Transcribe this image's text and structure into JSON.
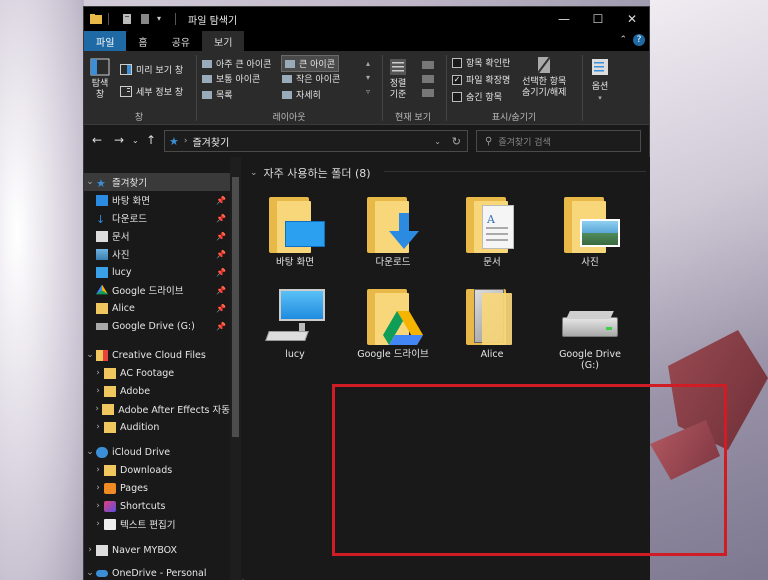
{
  "window": {
    "title": "파일 탐색기"
  },
  "ribbon_tabs": [
    "파일",
    "홈",
    "공유",
    "보기"
  ],
  "ribbon": {
    "pane_group": {
      "label": "창",
      "nav_pane": "탐색\n창",
      "preview_pane": "미리 보기 창",
      "details_pane": "세부 정보 창"
    },
    "layout_group": {
      "label": "레이아웃",
      "items": [
        "아주 큰 아이콘",
        "큰 아이콘",
        "보통 아이콘",
        "작은 아이콘",
        "목록",
        "자세히"
      ]
    },
    "current_view": {
      "label": "현재 보기",
      "sort": "정렬\n기준"
    },
    "show_hide": {
      "label": "표시/숨기기",
      "checkboxes": [
        {
          "label": "항목 확인란",
          "checked": false
        },
        {
          "label": "파일 확장명",
          "checked": true
        },
        {
          "label": "숨긴 항목",
          "checked": false
        }
      ],
      "hide_selected": "선택한 항목\n숨기기/해제"
    },
    "options": "옵션"
  },
  "address": {
    "path": "즐겨찾기",
    "search_placeholder": "즐겨찾기 검색"
  },
  "nav": [
    {
      "label": "즐겨찾기",
      "expanded": true,
      "level": 0,
      "selected": true,
      "icon": "star-icon"
    },
    {
      "label": "바탕 화면",
      "level": 1,
      "pinned": true,
      "icon": "desktop-icon"
    },
    {
      "label": "다운로드",
      "level": 1,
      "pinned": true,
      "icon": "download-icon"
    },
    {
      "label": "문서",
      "level": 1,
      "pinned": true,
      "icon": "document-icon"
    },
    {
      "label": "사진",
      "level": 1,
      "pinned": true,
      "icon": "picture-icon"
    },
    {
      "label": "lucy",
      "level": 1,
      "pinned": true,
      "icon": "computer-icon"
    },
    {
      "label": "Google 드라이브",
      "level": 1,
      "pinned": true,
      "icon": "google-drive-icon"
    },
    {
      "label": "Alice",
      "level": 1,
      "pinned": true,
      "icon": "folder-icon"
    },
    {
      "label": "Google Drive (G:)",
      "level": 1,
      "pinned": true,
      "icon": "drive-icon"
    },
    {
      "label": "Creative Cloud Files",
      "expanded": true,
      "level": 0,
      "icon": "creative-cloud-icon"
    },
    {
      "label": "AC Footage",
      "level": 1,
      "icon": "folder-icon"
    },
    {
      "label": "Adobe",
      "level": 1,
      "icon": "folder-icon"
    },
    {
      "label": "Adobe After Effects 자동",
      "level": 1,
      "icon": "folder-icon"
    },
    {
      "label": "Audition",
      "level": 1,
      "icon": "folder-icon"
    },
    {
      "label": "iCloud Drive",
      "expanded": true,
      "level": 0,
      "icon": "icloud-icon"
    },
    {
      "label": "Downloads",
      "level": 1,
      "icon": "folder-icon"
    },
    {
      "label": "Pages",
      "level": 1,
      "icon": "pages-icon"
    },
    {
      "label": "Shortcuts",
      "level": 1,
      "icon": "shortcuts-icon"
    },
    {
      "label": "텍스트 편집기",
      "level": 1,
      "icon": "textedit-icon"
    },
    {
      "label": "Naver MYBOX",
      "level": 0,
      "icon": "mybox-icon"
    },
    {
      "label": "OneDrive - Personal",
      "expanded": true,
      "level": 0,
      "icon": "onedrive-icon"
    }
  ],
  "content": {
    "section_title": "자주 사용하는 폴더 (8)",
    "tiles": [
      {
        "label": "바탕 화면",
        "kind": "desktop"
      },
      {
        "label": "다운로드",
        "kind": "download"
      },
      {
        "label": "문서",
        "kind": "document"
      },
      {
        "label": "사진",
        "kind": "picture"
      },
      {
        "label": "lucy",
        "kind": "computer"
      },
      {
        "label": "Google 드라이브",
        "kind": "gdrive"
      },
      {
        "label": "Alice",
        "kind": "alice"
      },
      {
        "label": "Google Drive\n(G:)",
        "kind": "drive"
      }
    ]
  },
  "colors": {
    "accent": "#1f6aa5",
    "highlight_box": "#d01c24",
    "folder": "#f7d77a"
  }
}
